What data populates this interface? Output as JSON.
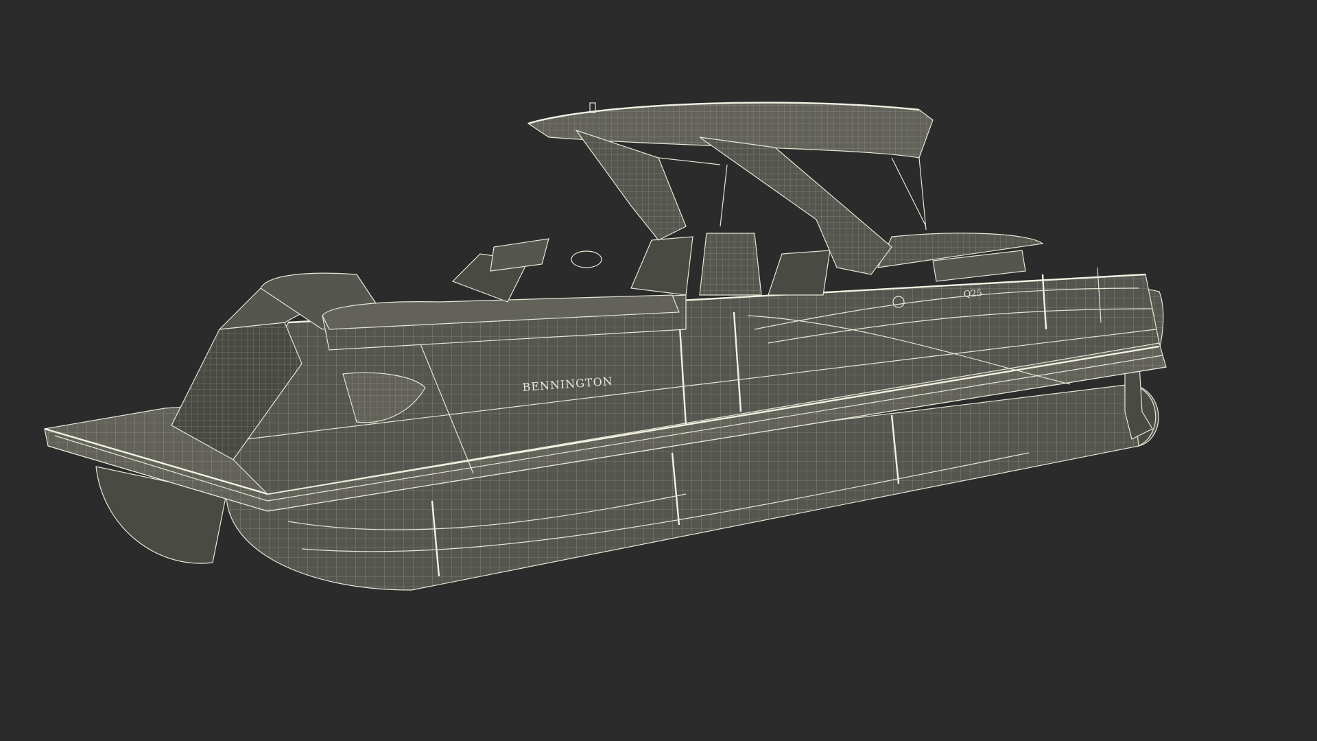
{
  "scene": {
    "background_color": "#2b2b2b",
    "wire_color": "#e6e8d6",
    "surface_color": "#565650"
  },
  "branding": {
    "hull_text": "BENNINGTON",
    "model_badge": "Q25"
  }
}
